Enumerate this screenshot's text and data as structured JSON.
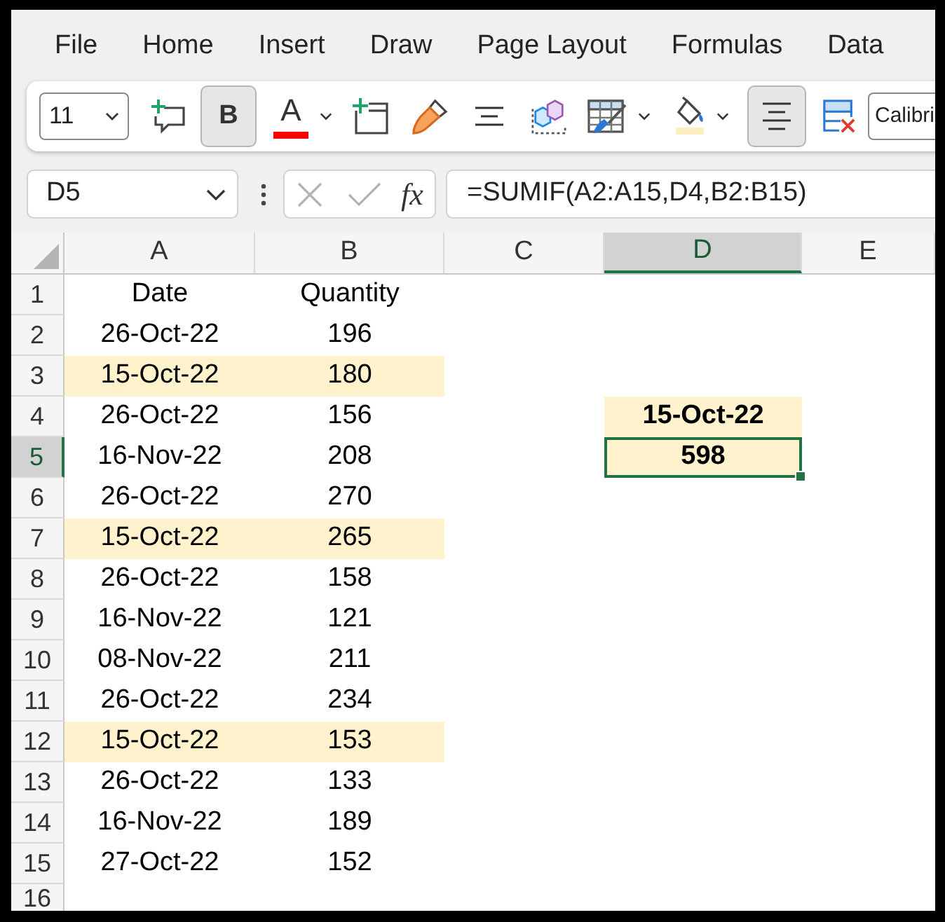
{
  "menu_tabs": [
    {
      "label": "File",
      "selected": false
    },
    {
      "label": "Home",
      "selected": false
    },
    {
      "label": "Insert",
      "selected": false
    },
    {
      "label": "Draw",
      "selected": false
    },
    {
      "label": "Page Layout",
      "selected": false
    },
    {
      "label": "Formulas",
      "selected": false
    },
    {
      "label": "Data",
      "selected": false
    }
  ],
  "toolbar": {
    "font_size": "11",
    "bold": {
      "label": "B",
      "selected": true
    },
    "font_color": {
      "label": "A"
    },
    "align_center": {
      "selected": true
    },
    "font_name": "Calibri"
  },
  "formula_bar": {
    "name_box": "D5",
    "function_label": "fx",
    "formula": "=SUMIF(A2:A15,D4,B2:B15)"
  },
  "sheet": {
    "columns": [
      {
        "label": "A",
        "selected": false
      },
      {
        "label": "B",
        "selected": false
      },
      {
        "label": "C",
        "selected": false
      },
      {
        "label": "D",
        "selected": true
      },
      {
        "label": "E",
        "selected": false
      }
    ],
    "rows": [
      {
        "number": "1",
        "selected": false,
        "cells": [
          {
            "value": "Date",
            "highlighted": false,
            "selected": false
          },
          {
            "value": "Quantity",
            "highlighted": false,
            "selected": false
          }
        ]
      },
      {
        "number": "2",
        "selected": false,
        "cells": [
          {
            "value": "26-Oct-22",
            "highlighted": false,
            "selected": false
          },
          {
            "value": "196",
            "highlighted": false,
            "selected": false
          }
        ]
      },
      {
        "number": "3",
        "selected": false,
        "cells": [
          {
            "value": "15-Oct-22",
            "highlighted": true,
            "selected": false
          },
          {
            "value": "180",
            "highlighted": true,
            "selected": false
          }
        ]
      },
      {
        "number": "4",
        "selected": false,
        "cells": [
          {
            "value": "26-Oct-22",
            "highlighted": false,
            "selected": false
          },
          {
            "value": "156",
            "highlighted": false,
            "selected": false
          }
        ]
      },
      {
        "number": "5",
        "selected": true,
        "cells": [
          {
            "value": "16-Nov-22",
            "highlighted": false,
            "selected": false
          },
          {
            "value": "208",
            "highlighted": false,
            "selected": false
          }
        ]
      },
      {
        "number": "6",
        "selected": false,
        "cells": [
          {
            "value": "26-Oct-22",
            "highlighted": false,
            "selected": false
          },
          {
            "value": "270",
            "highlighted": false,
            "selected": false
          }
        ]
      },
      {
        "number": "7",
        "selected": false,
        "cells": [
          {
            "value": "15-Oct-22",
            "highlighted": true,
            "selected": false
          },
          {
            "value": "265",
            "highlighted": true,
            "selected": false
          }
        ]
      },
      {
        "number": "8",
        "selected": false,
        "cells": [
          {
            "value": "26-Oct-22",
            "highlighted": false,
            "selected": false
          },
          {
            "value": "158",
            "highlighted": false,
            "selected": false
          }
        ]
      },
      {
        "number": "9",
        "selected": false,
        "cells": [
          {
            "value": "16-Nov-22",
            "highlighted": false,
            "selected": false
          },
          {
            "value": "121",
            "highlighted": false,
            "selected": false
          }
        ]
      },
      {
        "number": "10",
        "selected": false,
        "cells": [
          {
            "value": "08-Nov-22",
            "highlighted": false,
            "selected": false
          },
          {
            "value": "211",
            "highlighted": false,
            "selected": false
          }
        ]
      },
      {
        "number": "11",
        "selected": false,
        "cells": [
          {
            "value": "26-Oct-22",
            "highlighted": false,
            "selected": false
          },
          {
            "value": "234",
            "highlighted": false,
            "selected": false
          }
        ]
      },
      {
        "number": "12",
        "selected": false,
        "cells": [
          {
            "value": "15-Oct-22",
            "highlighted": true,
            "selected": false
          },
          {
            "value": "153",
            "highlighted": true,
            "selected": false
          }
        ]
      },
      {
        "number": "13",
        "selected": false,
        "cells": [
          {
            "value": "26-Oct-22",
            "highlighted": false,
            "selected": false
          },
          {
            "value": "133",
            "highlighted": false,
            "selected": false
          }
        ]
      },
      {
        "number": "14",
        "selected": false,
        "cells": [
          {
            "value": "16-Nov-22",
            "highlighted": false,
            "selected": false
          },
          {
            "value": "189",
            "highlighted": false,
            "selected": false
          }
        ]
      },
      {
        "number": "15",
        "selected": false,
        "cells": [
          {
            "value": "27-Oct-22",
            "highlighted": false,
            "selected": false
          },
          {
            "value": "152",
            "highlighted": false,
            "selected": false
          }
        ]
      },
      {
        "number": "16",
        "selected": false
      }
    ],
    "column_d_cells": [
      {
        "value": "15-Oct-22",
        "highlighted": true,
        "selected": false
      },
      {
        "value": "598",
        "highlighted": true,
        "selected": true
      }
    ]
  }
}
